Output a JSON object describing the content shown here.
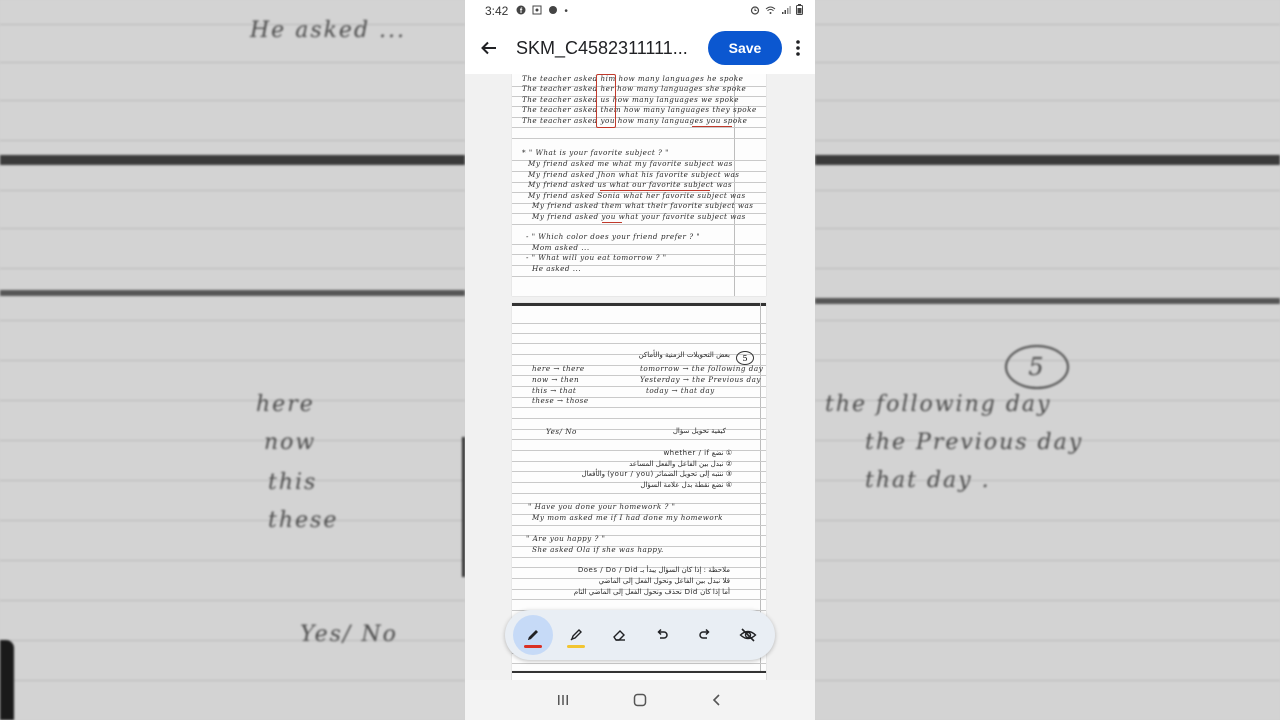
{
  "status_bar": {
    "time": "3:42",
    "left_icons": [
      "facebook-icon",
      "screenshot-icon",
      "android-icon"
    ],
    "right_icons": [
      "alarm-icon",
      "wifi-icon",
      "signal-icon",
      "battery-icon"
    ]
  },
  "app_bar": {
    "back_icon": "arrow-back-icon",
    "title": "SKM_C4582311111...",
    "save_label": "Save",
    "more_icon": "more-vert-icon"
  },
  "document": {
    "page1_lines": [
      "The teacher asked him how many languages he spoke",
      "The teacher asked her how many languages she spoke",
      "The teacher asked us how many languages we spoke",
      "The teacher asked them how many languages they spoke",
      "The teacher asked you how many languages you spoke",
      "* \" What is your favorite subject ? \"",
      "My friend asked me what my favorite subject was",
      "My friend asked Jhon what his favorite subject was",
      "My friend asked us what our favorite subject was",
      "My friend asked Sonia what her favorite subject was",
      "My friend asked them what their favorite subject was",
      "My friend asked you what your favorite subject was",
      "- \" Which color does your friend prefer ? \"",
      "Mom asked ...",
      "- \" What will you eat tomorrow ? \"",
      "He asked ..."
    ],
    "page2_lines": {
      "heading_ar": "بعض التحويلات الزمنية والأماكن",
      "circle_number": "5",
      "left_pairs": [
        "here → there",
        "now → then",
        "this → that",
        "these → those"
      ],
      "right_pairs": [
        "tomorrow → the following day",
        "Yesterday → the Previous day",
        "today → that day"
      ],
      "yesno_label": "Yes/ No",
      "yesno_ar": "كيفية تحويل سؤال",
      "rule_lines": [
        "① نضع whether / if",
        "② نبدل بين الفاعل والفعل المساعد",
        "③ ننتبه إلى تحويل الضمائر (your / you) والأفعال",
        "④ نضع نقطة بدل علامة السؤال"
      ],
      "example1_q": "\" Have you done your homework ? \"",
      "example1_a": "My mom asked me if I had done my homework",
      "example2_q": "\" Are you happy ? \"",
      "example2_a": "She asked Ola if she was happy.",
      "note_ar_1": "ملاحظة : إذا كان السؤال يبدأ بـ Does / Do / Did",
      "note_ar_2": "فلا نبدل بين الفاعل ونحول الفعل إلى الماضي",
      "note_ar_3": "أما إذا كان Did نحذف ونحول الفعل إلى الماضي التام"
    }
  },
  "toolbar": {
    "tools": [
      {
        "name": "pen",
        "icon": "pen-icon",
        "color": "#d93025",
        "active": true
      },
      {
        "name": "highlighter",
        "icon": "highlighter-icon",
        "color": "#f2c531",
        "active": false
      },
      {
        "name": "eraser",
        "icon": "eraser-icon",
        "active": false
      },
      {
        "name": "undo",
        "icon": "undo-icon",
        "active": false
      },
      {
        "name": "redo",
        "icon": "redo-icon",
        "active": false
      },
      {
        "name": "hide",
        "icon": "visibility-off-icon",
        "active": false
      }
    ]
  },
  "nav_bar": {
    "buttons": [
      "recent-apps-icon",
      "home-icon",
      "back-nav-icon"
    ]
  },
  "background": {
    "left_text": [
      "He asked ...",
      "here",
      "now",
      "this",
      "these",
      "Yes/ No"
    ],
    "right_text": [
      "the following day",
      "the Previous day",
      "that day .",
      "5"
    ]
  }
}
